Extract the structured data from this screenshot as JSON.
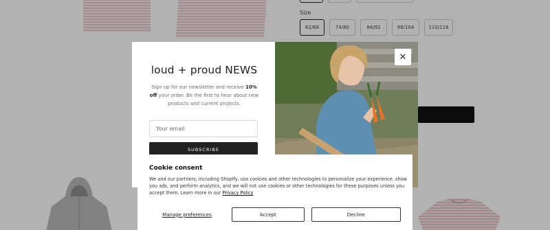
{
  "product_page": {
    "size_label": "Size",
    "sizes": [
      {
        "label": "62/68",
        "selected": true
      },
      {
        "label": "74/80",
        "selected": false
      },
      {
        "label": "86/92",
        "selected": false
      },
      {
        "label": "98/104",
        "selected": false
      },
      {
        "label": "110/116",
        "selected": false
      }
    ]
  },
  "newsletter": {
    "title": "loud + proud NEWS",
    "text_before": "Sign up for our newsletter and receive ",
    "discount": "10% off",
    "text_after": " your order. Be the first to hear about new products and current projects.",
    "email_placeholder": "Your email",
    "subscribe_label": "SUBSCRIBE",
    "close_icon": "close-icon"
  },
  "cookie_consent": {
    "title": "Cookie consent",
    "text": "We and our partners, including Shopify, use cookies and other technologies to personalize your experience, show you ads, and perform analytics, and we will not use cookies or other technologies for these purposes unless you accept them. Learn more in our ",
    "link_label": "Privacy Policy",
    "manage_label": "Manage preferences",
    "accept_label": "Accept",
    "decline_label": "Decline"
  },
  "colors": {
    "overlay": "rgba(0,0,0,0.30)",
    "button_dark": "#222222",
    "product_pink": "#f1d9dc"
  }
}
